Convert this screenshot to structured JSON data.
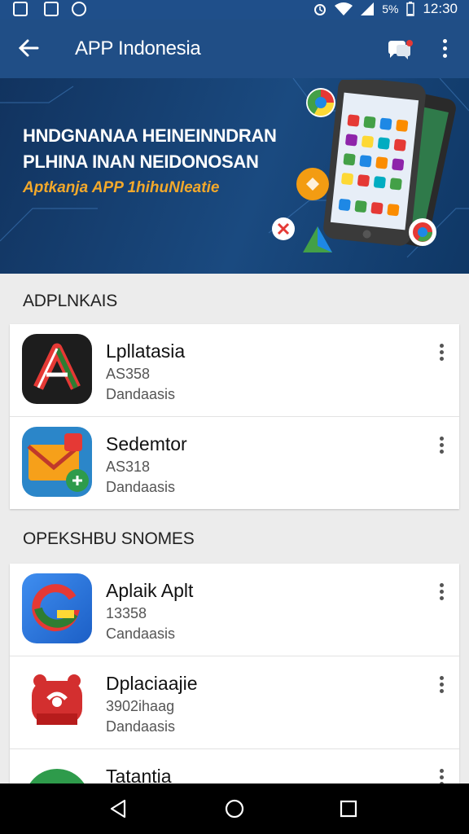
{
  "status_bar": {
    "time": "12:30",
    "battery": "5%"
  },
  "appbar": {
    "title": "APP Indonesia"
  },
  "banner": {
    "line1": "HNDGNANAA HEINEINNDRAN",
    "line2": "PLHINA INAN NEIDONOSAN",
    "line3": "Aptkanja APP 1hihuNleatie"
  },
  "sections": [
    {
      "title": "ADPLNKAIS",
      "apps": [
        {
          "name": "Lpllatasia",
          "line2": "AS358",
          "line3": "Dandaasis",
          "icon": "red-a-logo-icon"
        },
        {
          "name": "Sedemtor",
          "line2": "AS318",
          "line3": "Dandaasis",
          "icon": "mail-envelope-icon"
        }
      ]
    },
    {
      "title": "OPEKSHBU SNOMES",
      "apps": [
        {
          "name": "Aplaik Aplt",
          "line2": "13358",
          "line3": "Candaasis",
          "icon": "g-logo-icon"
        },
        {
          "name": "Dplaciaajie",
          "line2": "3902ihaag",
          "line3": "Dandaasis",
          "icon": "red-mascot-icon"
        },
        {
          "name": "Tatantia",
          "line2": "",
          "line3": "",
          "icon": "green-yellow-icon"
        }
      ]
    }
  ]
}
